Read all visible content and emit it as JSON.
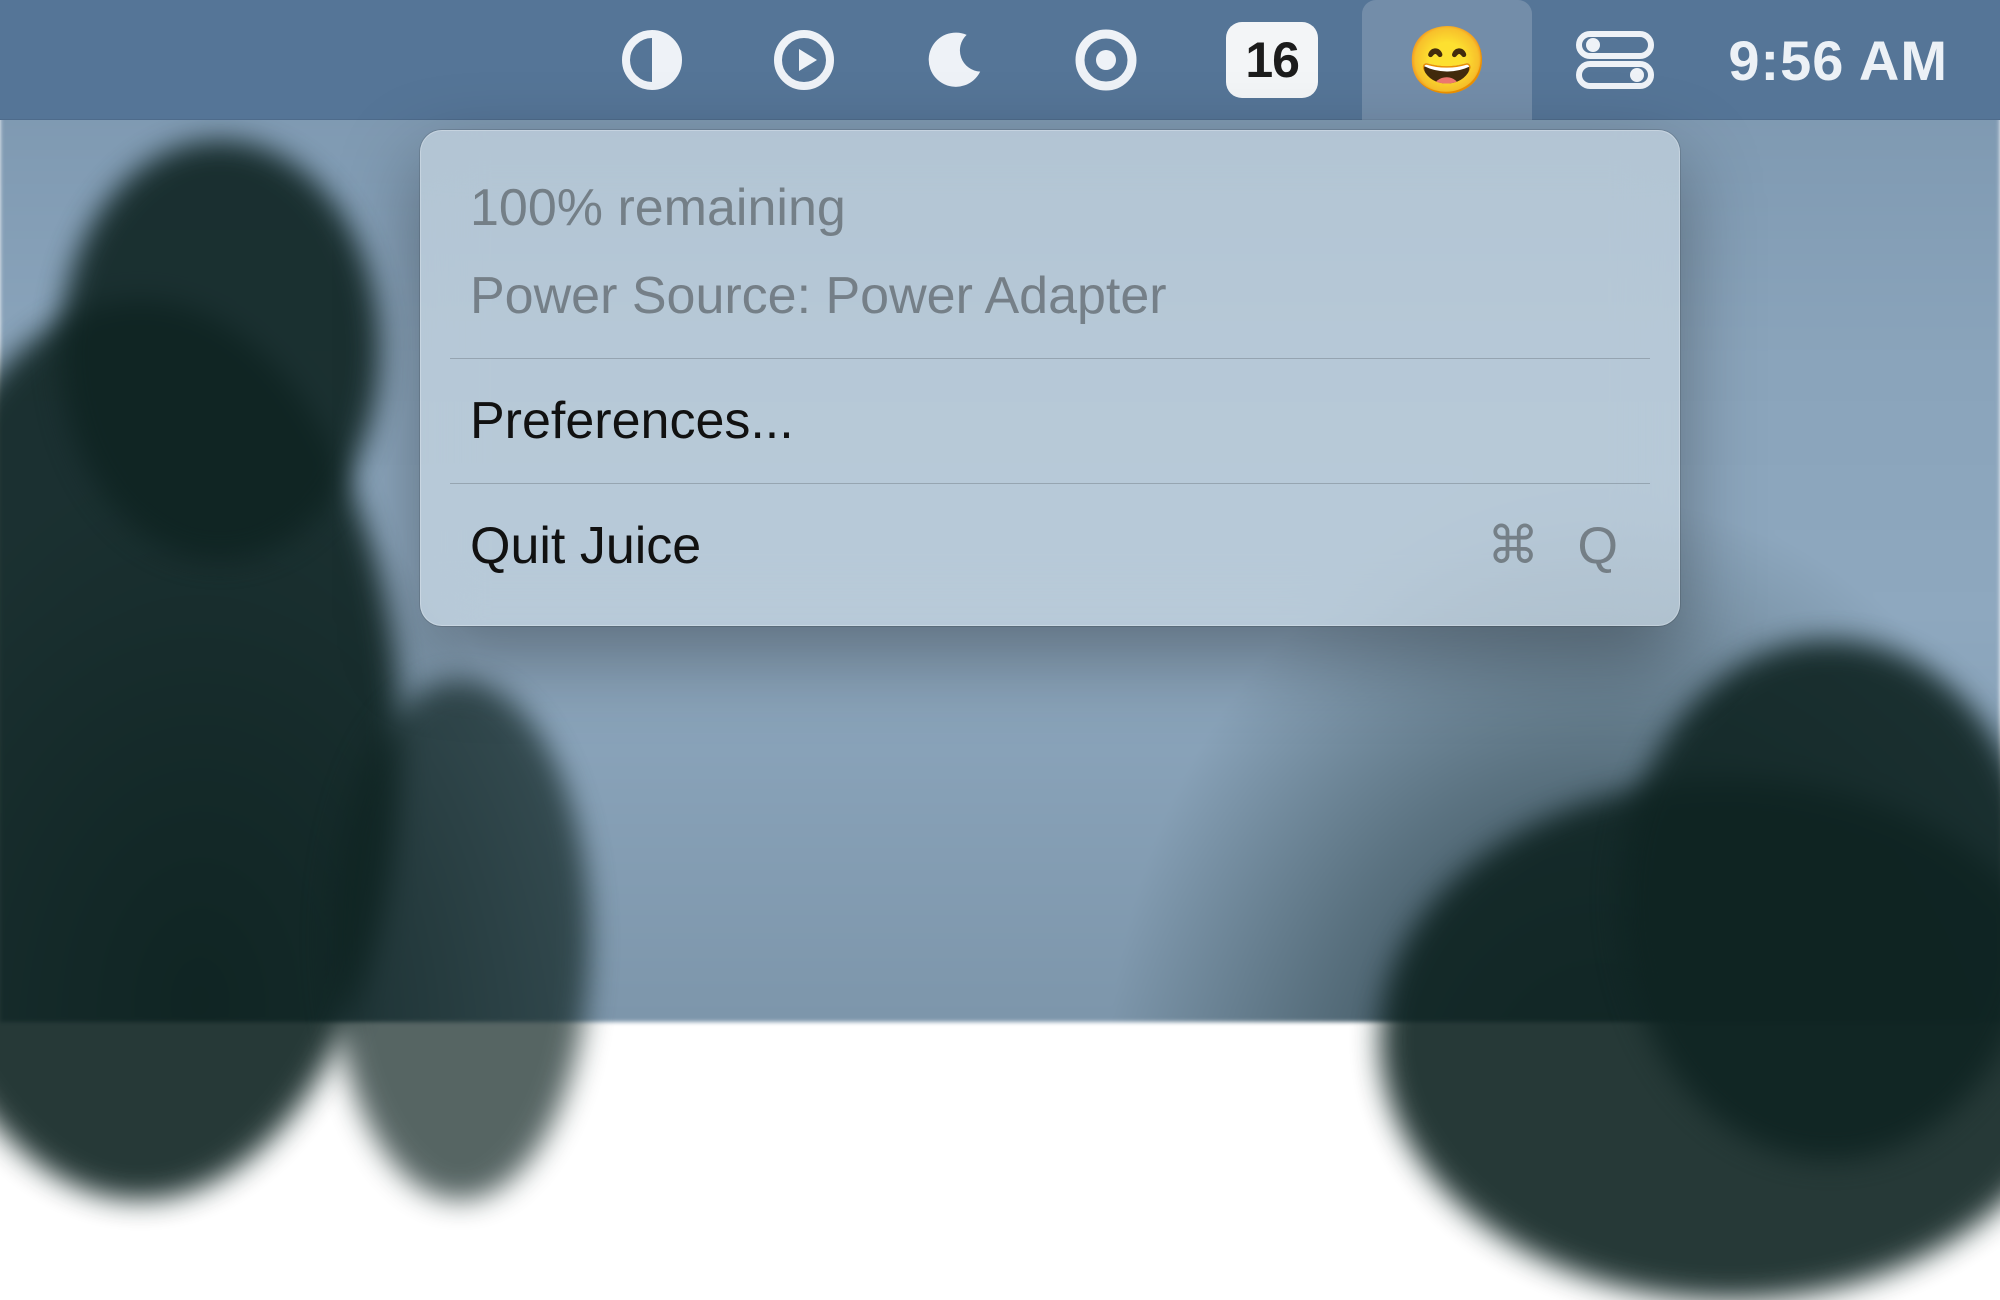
{
  "menubar": {
    "items": [
      {
        "name": "display-half-icon"
      },
      {
        "name": "play-circle-icon"
      },
      {
        "name": "moon-icon"
      },
      {
        "name": "record-circle-icon"
      },
      {
        "name": "calendar-icon",
        "day": "16"
      },
      {
        "name": "juice-emoji-icon",
        "emoji": "😄"
      },
      {
        "name": "control-center-icon"
      }
    ],
    "clock": "9:56 AM"
  },
  "dropdown": {
    "status_remaining": "100% remaining",
    "status_power_source": "Power Source: Power Adapter",
    "preferences_label": "Preferences...",
    "quit_label": "Quit Juice",
    "quit_shortcut": "⌘ Q"
  }
}
